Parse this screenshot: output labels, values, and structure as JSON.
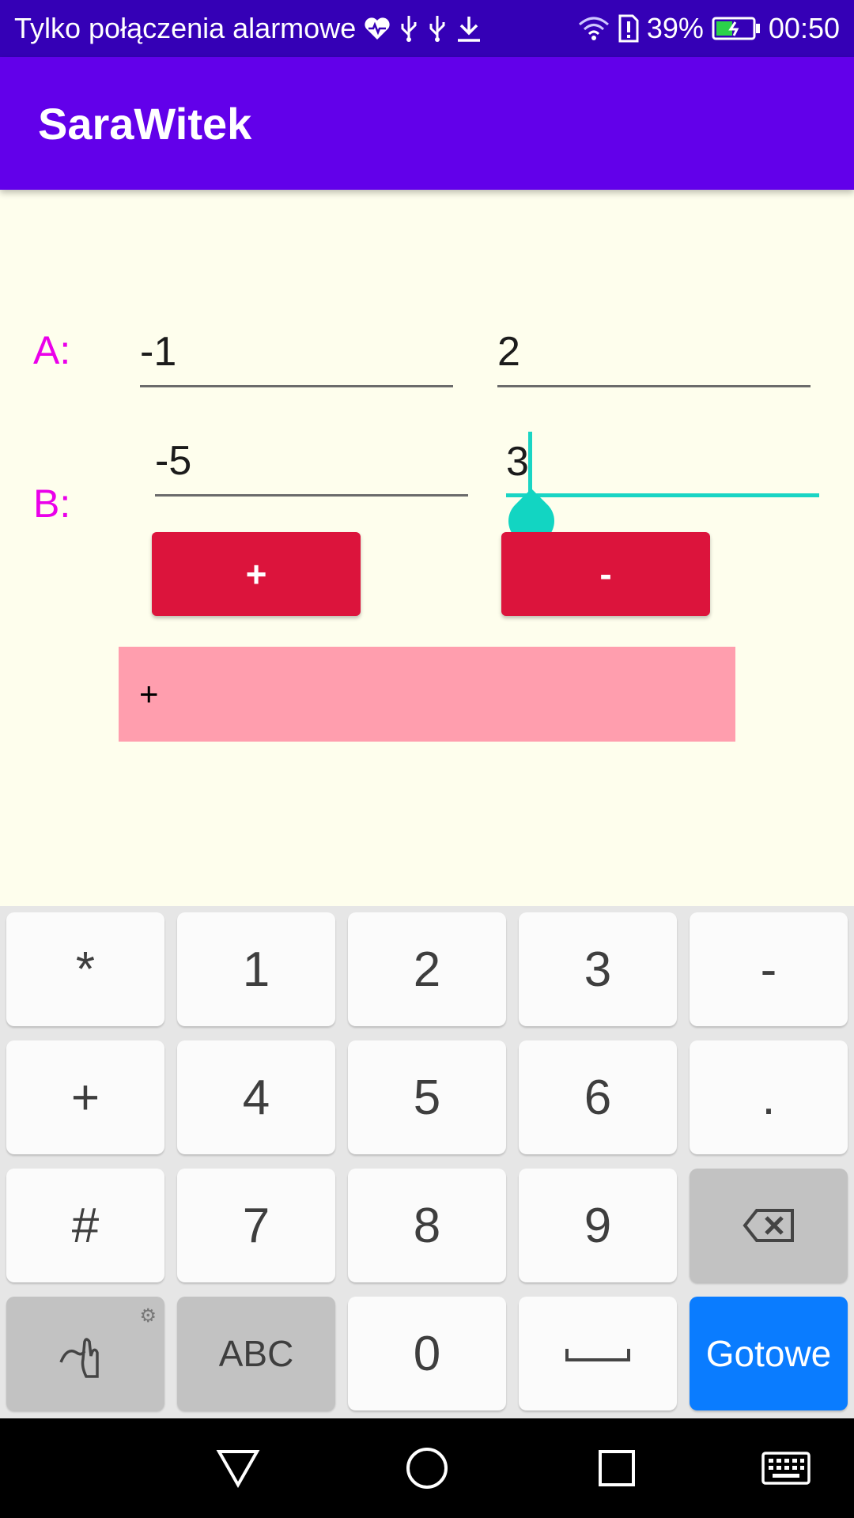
{
  "status_bar": {
    "carrier": "Tylko połączenia alarmowe",
    "battery": "39%",
    "time": "00:50"
  },
  "app_bar": {
    "title": "SaraWitek"
  },
  "form": {
    "row_a": {
      "label": "A:",
      "field1": "-1",
      "field2": "2"
    },
    "row_b": {
      "label": "B:",
      "field1": "-5",
      "field2": "3"
    },
    "plus_button": "+",
    "minus_button": "-",
    "result": "+"
  },
  "keyboard": {
    "keys": {
      "star": "*",
      "k1": "1",
      "k2": "2",
      "k3": "3",
      "dash": "-",
      "plus": "+",
      "k4": "4",
      "k5": "5",
      "k6": "6",
      "dot": ".",
      "hash": "#",
      "k7": "7",
      "k8": "8",
      "k9": "9",
      "abc": "ABC",
      "k0": "0",
      "done": "Gotowe"
    }
  },
  "colors": {
    "status_bar": "#3500b6",
    "app_bar": "#6200ea",
    "label": "#ea00ea",
    "button": "#dc143c",
    "result_bg": "#ff9eae",
    "focus": "#1ad5c4",
    "done_key": "#0a7cff"
  }
}
